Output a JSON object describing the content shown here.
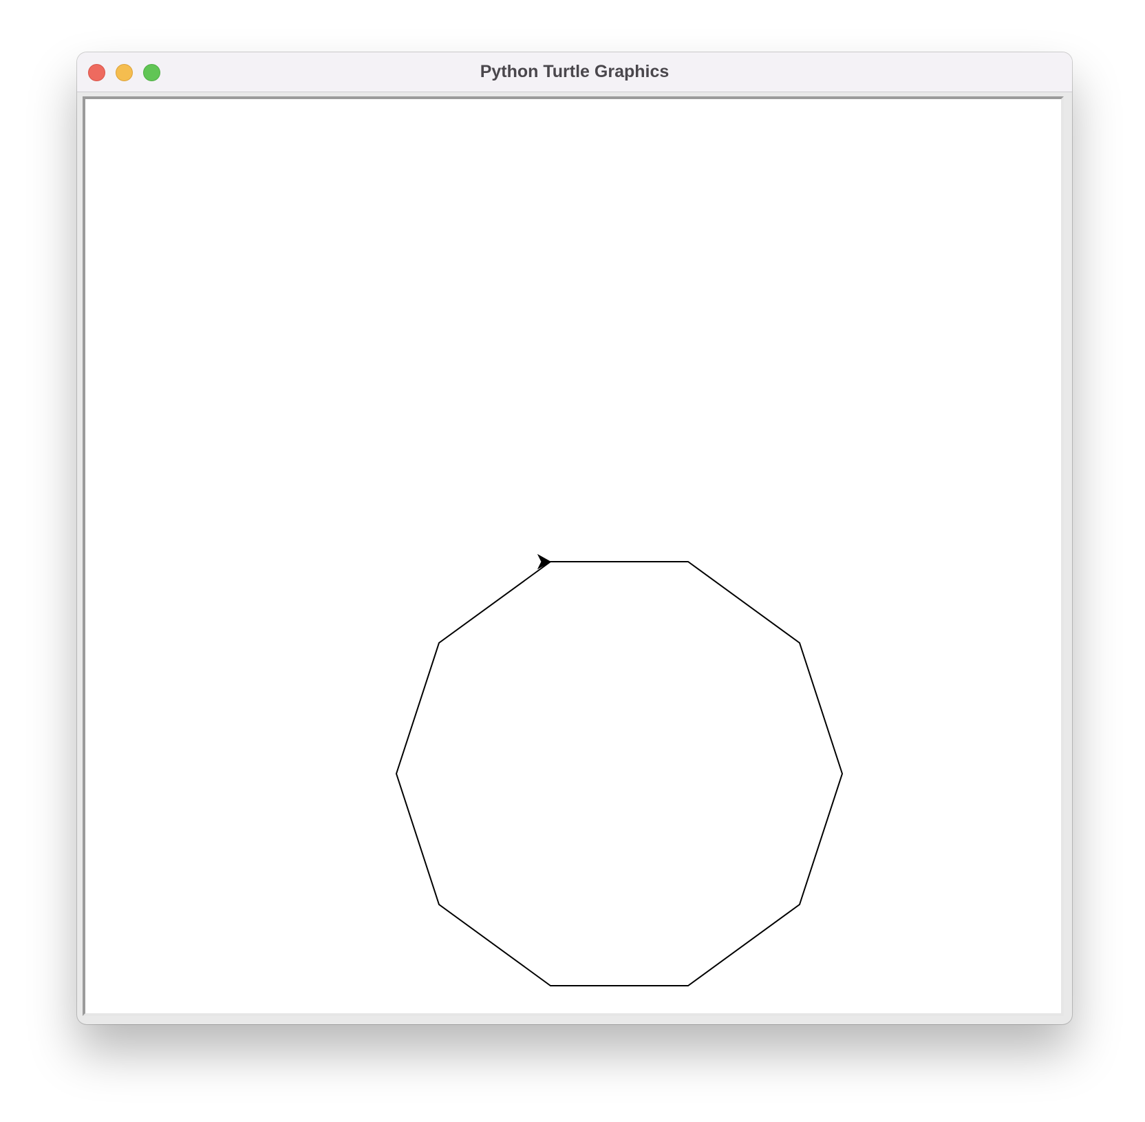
{
  "window": {
    "title": "Python Turtle Graphics"
  },
  "colors": {
    "pen": "#000000",
    "canvas_background": "#ffffff",
    "close_button": "#ee6a5f",
    "minimize_button": "#f5bd4f",
    "zoom_button": "#61c555"
  },
  "turtle": {
    "shape": "classic-arrow",
    "heading_degrees": 0,
    "drawing": "regular decagon"
  }
}
